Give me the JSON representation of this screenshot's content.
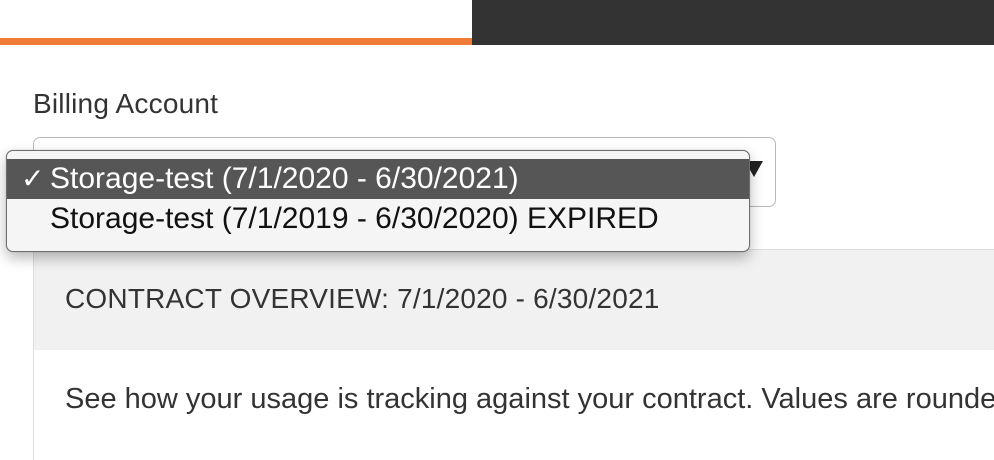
{
  "billing": {
    "label": "Billing Account",
    "selected_value": "Storage-test (7/1/2020 - 6/30/2021)",
    "options": [
      {
        "label": "Storage-test (7/1/2020 - 6/30/2021)",
        "selected": true,
        "check": "✓"
      },
      {
        "label": "Storage-test (7/1/2019 - 6/30/2020) EXPIRED",
        "selected": false,
        "check": ""
      }
    ]
  },
  "contract": {
    "title": "CONTRACT OVERVIEW: 7/1/2020 - 6/30/2021",
    "description": "See how your usage is tracking against your contract. Values are rounded"
  },
  "colors": {
    "accent": "#f07b36",
    "header_dark": "#333333",
    "selected_option_bg": "#565656",
    "logo_pink": "#e0237f"
  },
  "icons": {
    "caret": "chevron-down-icon",
    "check": "checkmark-icon"
  }
}
